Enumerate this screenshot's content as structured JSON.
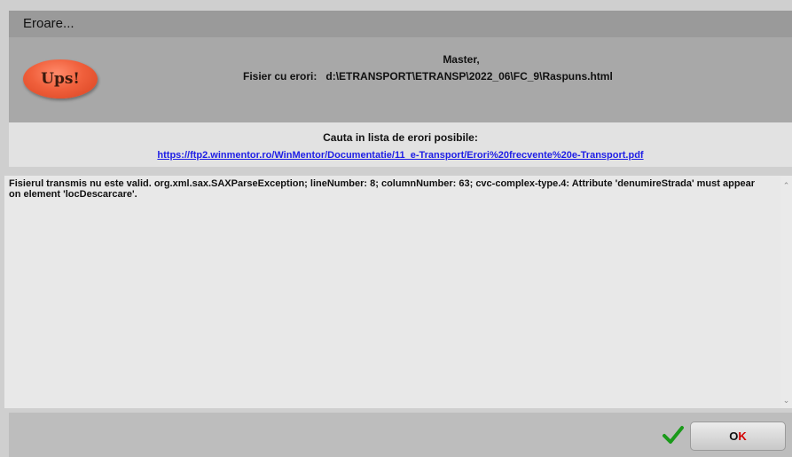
{
  "window": {
    "title": "Eroare..."
  },
  "header": {
    "ups_label": "Ups!",
    "greeting": "Master,",
    "file_label": "Fisier cu erori:",
    "file_path": "d:\\ETRANSPORT\\ETRANSP\\2022_06\\FC_9\\Raspuns.html"
  },
  "help": {
    "label": "Cauta in lista de erori posibile:",
    "url": "https://ftp2.winmentor.ro/WinMentor/Documentatie/11_e-Transport/Erori%20frecvente%20e-Transport.pdf"
  },
  "error": {
    "message": "Fisierul transmis nu este valid. org.xml.sax.SAXParseException; lineNumber: 8; columnNumber: 63; cvc-complex-type.4: Attribute 'denumireStrada' must appear on element 'locDescarcare'."
  },
  "footer": {
    "ok_first": "O",
    "ok_second": "K",
    "check_icon": "green-check-icon"
  },
  "colors": {
    "accent_red": "#d40000",
    "link_blue": "#1e1ee6",
    "check_green": "#1a9a1a",
    "ups_orange": "#f0603c"
  }
}
